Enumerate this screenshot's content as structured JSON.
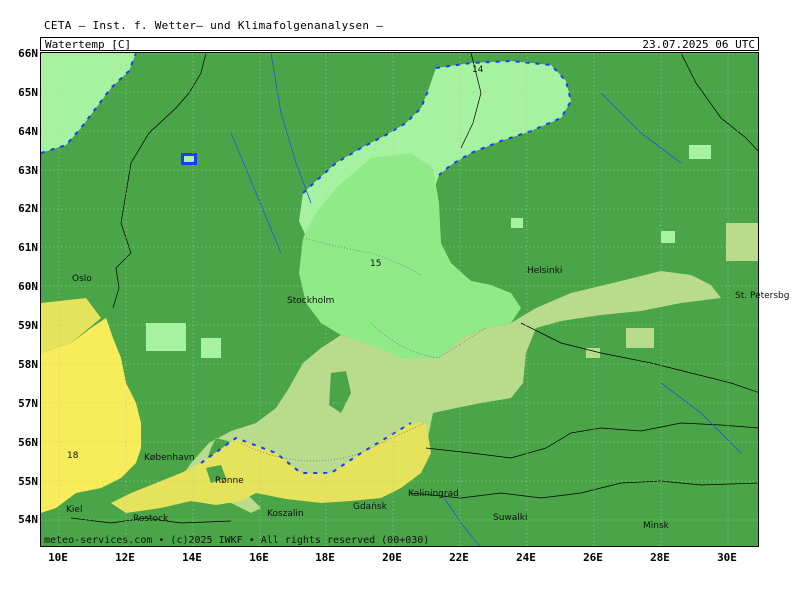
{
  "header": {
    "source": "CETA – Inst. f. Wetter– und Klimafolgenanalysen –",
    "parameter": "Watertemp [C]",
    "datetime": "23.07.2025 06 UTC"
  },
  "axes": {
    "lat_labels": [
      "66N",
      "65N",
      "64N",
      "63N",
      "62N",
      "61N",
      "60N",
      "59N",
      "58N",
      "57N",
      "56N",
      "55N",
      "54N"
    ],
    "lon_labels": [
      "10E",
      "12E",
      "14E",
      "16E",
      "18E",
      "20E",
      "22E",
      "24E",
      "26E",
      "28E",
      "30E"
    ]
  },
  "cities": [
    "Oslo",
    "Stockholm",
    "Helsinki",
    "St. Petersbg",
    "København",
    "Rønne",
    "Kiel",
    "Rostock",
    "Koszalin",
    "Gdańsk",
    "Kaliningrad",
    "Suwalki",
    "Minsk"
  ],
  "contour_labels": [
    "14",
    "15",
    "18"
  ],
  "footer": "meteo-services.com • (c)2025 IWKF • All rights reserved (00+030)",
  "colors": {
    "land": "#49a547",
    "water_14": "#a6f2a0",
    "water_15": "#8fea88",
    "water_16": "#b9dc8c",
    "water_18": "#e5e25c",
    "water_19": "#f7ec5a",
    "coast_edge": "#1a3cff",
    "grid": "#bdbdbd"
  }
}
